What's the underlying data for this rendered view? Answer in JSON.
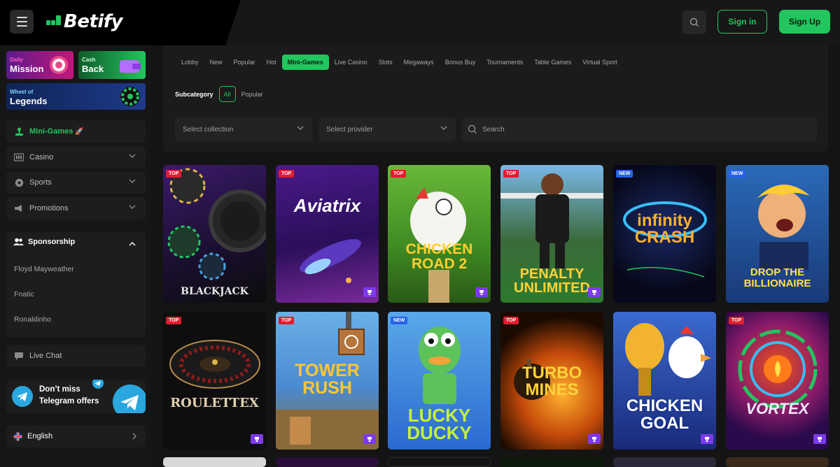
{
  "brand": {
    "name": "Betify",
    "accent": "#22c55e"
  },
  "header": {
    "signin_label": "Sign in",
    "signup_label": "Sign Up"
  },
  "sidebar": {
    "promos": [
      {
        "small": "Daily",
        "big": "Mission"
      },
      {
        "small": "Cash",
        "big": "Back"
      },
      {
        "small": "Wheel of",
        "big": "Legends"
      }
    ],
    "items": [
      {
        "label": "Mini-Games",
        "icon": "joystick-icon",
        "active": true
      },
      {
        "label": "Casino",
        "icon": "slot-machine-icon"
      },
      {
        "label": "Sports",
        "icon": "ball-icon"
      },
      {
        "label": "Promotions",
        "icon": "megaphone-icon"
      }
    ],
    "sponsorship": {
      "title": "Sponsorship",
      "items": [
        "Floyd Mayweather",
        "Fnatic",
        "Ronaldinho"
      ]
    },
    "live_chat": "Live Chat",
    "telegram": {
      "line1": "Don’t miss",
      "line2": "Telegram offers"
    },
    "language": "English"
  },
  "filters": {
    "tabs": [
      "Lobby",
      "New",
      "Popular",
      "Hot",
      "Mini-Games",
      "Live Casino",
      "Slots",
      "Megaways",
      "Bonus Buy",
      "Tournaments",
      "Table Games",
      "Virtual Sport"
    ],
    "active_tab": "Mini-Games",
    "subcategory_label": "Subcategory",
    "subcategories": [
      "All",
      "Popular"
    ],
    "collection_placeholder": "Select collection",
    "provider_placeholder": "Select provider",
    "search_placeholder": "Search"
  },
  "games": [
    {
      "title": "BLACKJACK",
      "badge": "TOP",
      "trophy": false
    },
    {
      "title": "Aviatrix",
      "badge": "TOP",
      "trophy": true
    },
    {
      "title": "CHICKEN ROAD 2",
      "badge": "TOP",
      "trophy": true
    },
    {
      "title": "PENALTY UNLIMITED",
      "badge": "TOP",
      "trophy": true
    },
    {
      "title": "infinity CRASH",
      "badge": "NEW",
      "trophy": false
    },
    {
      "title": "DROP THE BILLIONAIRE",
      "badge": "NEW",
      "trophy": false
    },
    {
      "title": "ROULETTEX",
      "badge": "TOP",
      "trophy": true
    },
    {
      "title": "TOWER RUSH",
      "badge": "TOP",
      "trophy": true
    },
    {
      "title": "LUCKY DUCKY",
      "badge": "NEW",
      "trophy": false
    },
    {
      "title": "TURBO MINES",
      "badge": "TOP",
      "trophy": true
    },
    {
      "title": "CHICKEN GOAL",
      "badge": "",
      "trophy": true
    },
    {
      "title": "VORTEX",
      "badge": "TOP",
      "trophy": true
    }
  ]
}
